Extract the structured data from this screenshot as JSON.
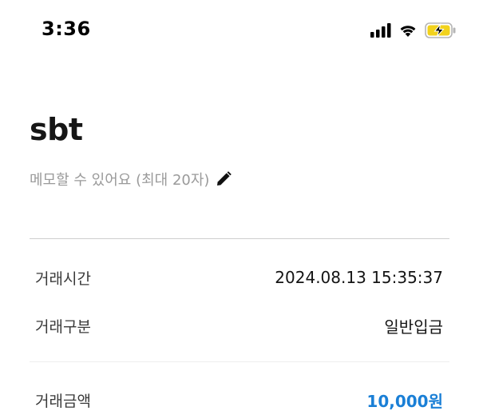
{
  "status_bar": {
    "time": "3:36",
    "icons": [
      "cellular-signal-icon",
      "wifi-icon",
      "battery-charging-icon"
    ],
    "battery_color": "#f2d21c"
  },
  "header": {
    "title": "sbt",
    "memo_placeholder": "메모할 수 있어요 (최대 20자)",
    "edit_icon": "pencil-icon"
  },
  "details": [
    {
      "label": "거래시간",
      "value": "2024.08.13 15:35:37"
    },
    {
      "label": "거래구분",
      "value": "일반입금"
    }
  ],
  "amount": {
    "label": "거래금액",
    "value": "10,000",
    "unit": "원",
    "color": "#1a7fd6"
  }
}
